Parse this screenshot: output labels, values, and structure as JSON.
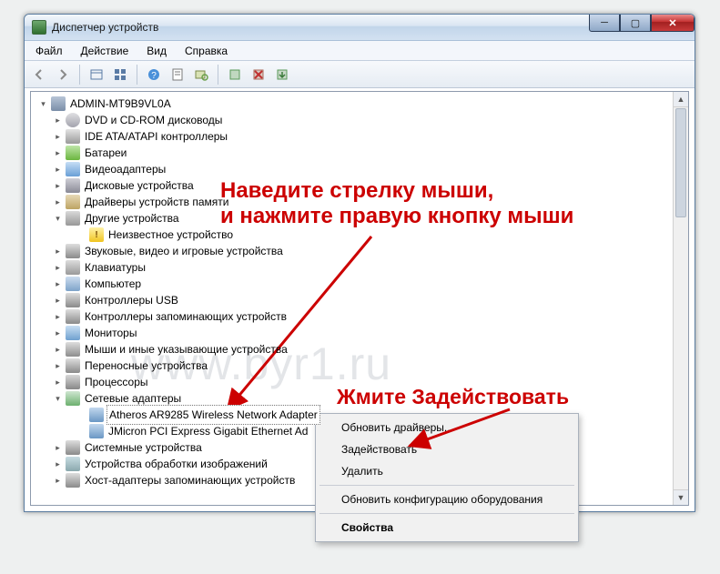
{
  "window": {
    "title": "Диспетчер устройств"
  },
  "menu": {
    "file": "Файл",
    "action": "Действие",
    "view": "Вид",
    "help": "Справка"
  },
  "tree": {
    "root": "ADMIN-MT9B9VL0A",
    "dvd": "DVD и CD-ROM дисководы",
    "ide": "IDE ATA/ATAPI контроллеры",
    "battery": "Батареи",
    "video": "Видеоадаптеры",
    "disks": "Дисковые устройства",
    "memdrv": "Драйверы устройств памяти",
    "other": "Другие устройства",
    "unknown": "Неизвестное устройство",
    "sound": "Звуковые, видео и игровые устройства",
    "keyboard": "Клавиатуры",
    "computer": "Компьютер",
    "usb": "Контроллеры USB",
    "storage": "Контроллеры запоминающих устройств",
    "monitors": "Мониторы",
    "mice": "Мыши и иные указывающие устройства",
    "portable": "Переносные устройства",
    "cpu": "Процессоры",
    "netadapters": "Сетевые адаптеры",
    "atheros": "Atheros AR9285 Wireless Network Adapter",
    "jmicron": "JMicron PCI Express Gigabit Ethernet Ad",
    "system": "Системные устройства",
    "imaging": "Устройства обработки изображений",
    "host": "Хост-адаптеры запоминающих устройств"
  },
  "context": {
    "update": "Обновить драйверы...",
    "enable": "Задействовать",
    "delete": "Удалить",
    "scan": "Обновить конфигурацию оборудования",
    "properties": "Свойства"
  },
  "annotations": {
    "line1a": "Наведите стрелку мыши,",
    "line1b": "и нажмите правую кнопку мыши",
    "line2": "Жмите Задействовать"
  },
  "watermark": "www.byr1.ru"
}
